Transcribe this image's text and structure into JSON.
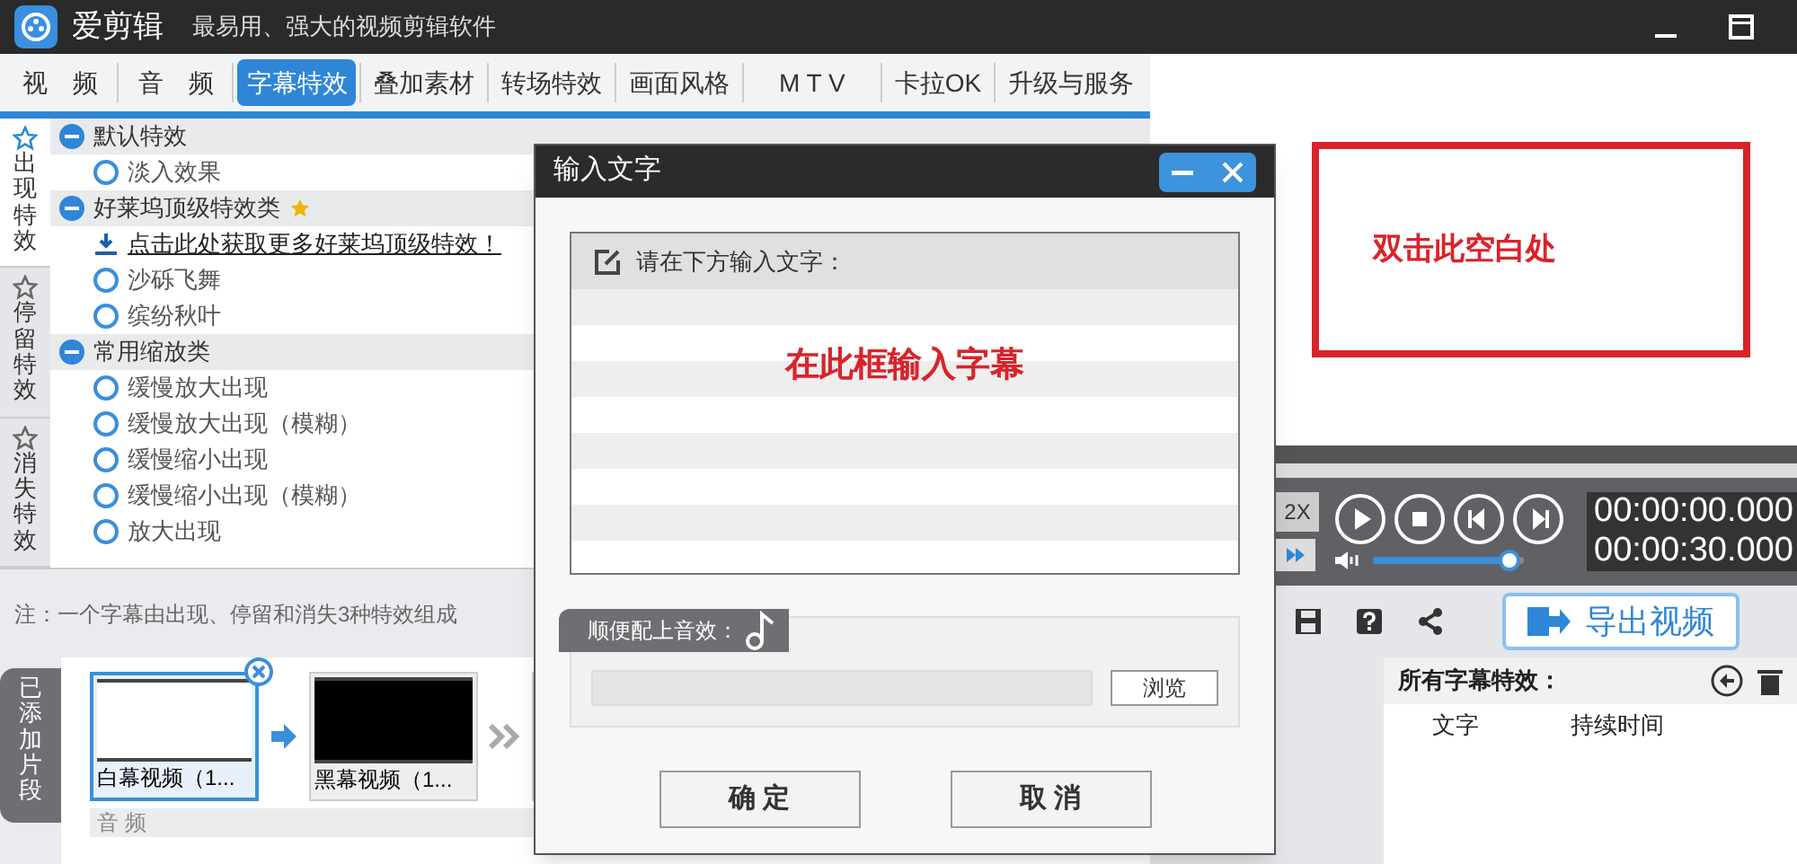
{
  "app": {
    "name": "爱剪辑",
    "slogan": "最易用、强大的视频剪辑软件"
  },
  "tabs": [
    {
      "label": "视　频",
      "selected": false
    },
    {
      "label": "音　频",
      "selected": false
    },
    {
      "label": "字幕特效",
      "selected": true
    },
    {
      "label": "叠加素材",
      "selected": false
    },
    {
      "label": "转场特效",
      "selected": false
    },
    {
      "label": "画面风格",
      "selected": false
    },
    {
      "label": "M T V",
      "selected": false
    },
    {
      "label": "卡拉OK",
      "selected": false
    },
    {
      "label": "升级与服务",
      "selected": false
    }
  ],
  "effect_categories": [
    {
      "label": "出现特效",
      "selected": true
    },
    {
      "label": "停留特效",
      "selected": false
    },
    {
      "label": "消失特效",
      "selected": false
    }
  ],
  "effect_groups": [
    {
      "title": "默认特效",
      "starred": false,
      "items": [
        {
          "kind": "radio",
          "label": "淡入效果",
          "selected": false
        }
      ]
    },
    {
      "title": "好莱坞顶级特效类",
      "starred": true,
      "items": [
        {
          "kind": "link",
          "label": "点击此处获取更多好莱坞顶级特效！"
        },
        {
          "kind": "radio",
          "label": "沙砾飞舞",
          "selected": false
        },
        {
          "kind": "radio",
          "label": "缤纷秋叶",
          "selected": false
        }
      ]
    },
    {
      "title": "常用缩放类",
      "starred": false,
      "items": [
        {
          "kind": "radio",
          "label": "缓慢放大出现",
          "selected": false
        },
        {
          "kind": "radio",
          "label": "缓慢放大出现（模糊）",
          "selected": false
        },
        {
          "kind": "radio",
          "label": "缓慢缩小出现",
          "selected": false
        },
        {
          "kind": "radio",
          "label": "缓慢缩小出现（模糊）",
          "selected": false
        },
        {
          "kind": "radio",
          "label": "放大出现",
          "selected": false
        }
      ]
    }
  ],
  "note": "注：一个字幕由出现、停留和消失3种特效组成",
  "timeline": {
    "tab": "已添加片段",
    "clips": [
      {
        "label": "白幕视频（1...",
        "color": "#ffffff",
        "selected": true
      },
      {
        "label": "黑幕视频（1...",
        "color": "#000000",
        "selected": false
      }
    ],
    "audio_label": "音 频"
  },
  "preview": {
    "annotation": "双击此空白处"
  },
  "player": {
    "speed": "2X",
    "time_current": "00:00:00.000",
    "time_total": "00:00:30.000",
    "volume": {
      "level": 0.9
    }
  },
  "export_button": "导出视频",
  "subtitle_panel": {
    "title": "所有字幕特效：",
    "columns": [
      "文字",
      "持续时间"
    ]
  },
  "dialog": {
    "title": "输入文字",
    "prompt": "请在下方输入文字：",
    "annotation": "在此框输入字幕",
    "sound_label": "顺便配上音效：",
    "browse": "浏览",
    "ok": "确 定",
    "cancel": "取 消"
  }
}
